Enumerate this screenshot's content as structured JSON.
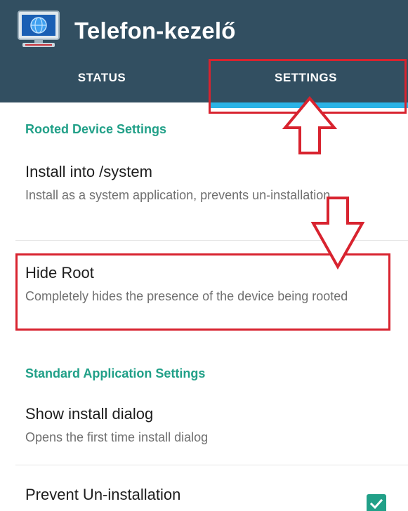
{
  "app": {
    "title": "Telefon-kezelő",
    "icon": "monitor-globe-icon"
  },
  "tabs": [
    {
      "label": "STATUS",
      "selected": false
    },
    {
      "label": "SETTINGS",
      "selected": true
    }
  ],
  "sections": [
    {
      "header": "Rooted Device Settings",
      "items": [
        {
          "title": "Install into /system",
          "summary": "Install as a system application, prevents un-installation"
        },
        {
          "title": "Hide Root",
          "summary": "Completely hides the presence of the device being rooted"
        }
      ]
    },
    {
      "header": "Standard Application Settings",
      "items": [
        {
          "title": "Show install dialog",
          "summary": "Opens the first time install dialog"
        },
        {
          "title": "Prevent Un-installation",
          "checked": true
        }
      ]
    }
  ],
  "colors": {
    "appbar": "#324f61",
    "tab_indicator": "#2bb3e6",
    "section_header": "#21a088",
    "annotation": "#d8232f"
  }
}
